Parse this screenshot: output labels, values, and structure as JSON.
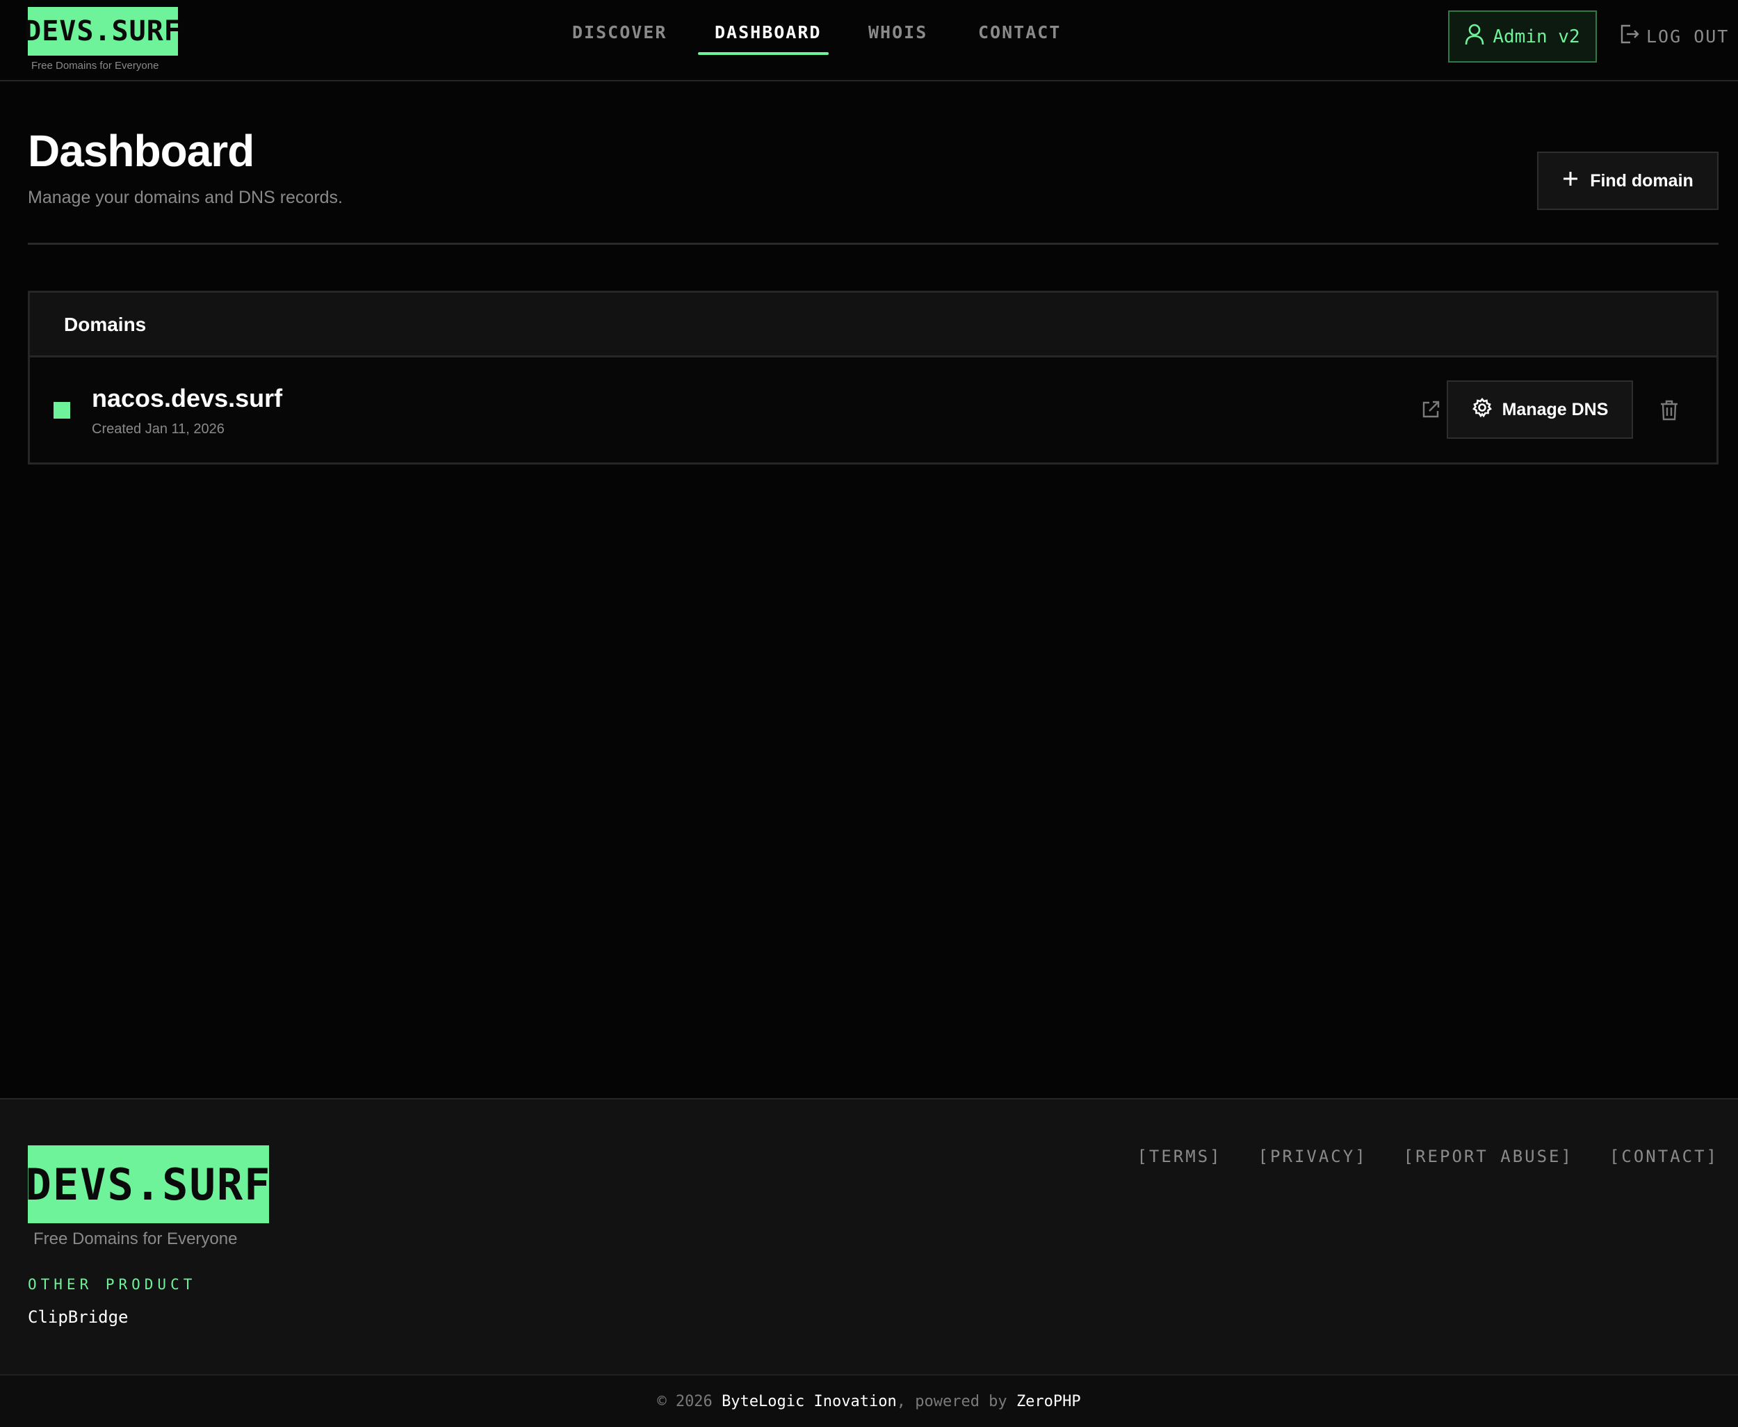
{
  "brand": {
    "logo_text": "DEVS.SURF",
    "tagline": "Free Domains for Everyone",
    "accent_color": "#6ef29a"
  },
  "nav": {
    "items": [
      {
        "label": "DISCOVER",
        "active": false
      },
      {
        "label": "DASHBOARD",
        "active": true
      },
      {
        "label": "WHOIS",
        "active": false
      },
      {
        "label": "CONTACT",
        "active": false
      }
    ],
    "user_label": "Admin v2",
    "logout_label": "LOG OUT"
  },
  "page": {
    "title": "Dashboard",
    "subtitle": "Manage your domains and DNS records.",
    "find_domain_label": "Find domain"
  },
  "domains": {
    "panel_title": "Domains",
    "rows": [
      {
        "name": "nacos.devs.surf",
        "created": "Created Jan 11, 2026",
        "status_color": "#6ef29a",
        "manage_label": "Manage DNS"
      }
    ]
  },
  "footer": {
    "logo_text": "DEVS.SURF",
    "tagline": "Free Domains for Everyone",
    "other_product_label": "OTHER PRODUCT",
    "other_product_link": "ClipBridge",
    "links": [
      "[TERMS]",
      "[PRIVACY]",
      "[REPORT ABUSE]",
      "[CONTACT]"
    ],
    "copyright_prefix": "© 2026",
    "company": "ByteLogic Inovation",
    "powered_text": ", powered by",
    "powered_by": "ZeroPHP"
  }
}
